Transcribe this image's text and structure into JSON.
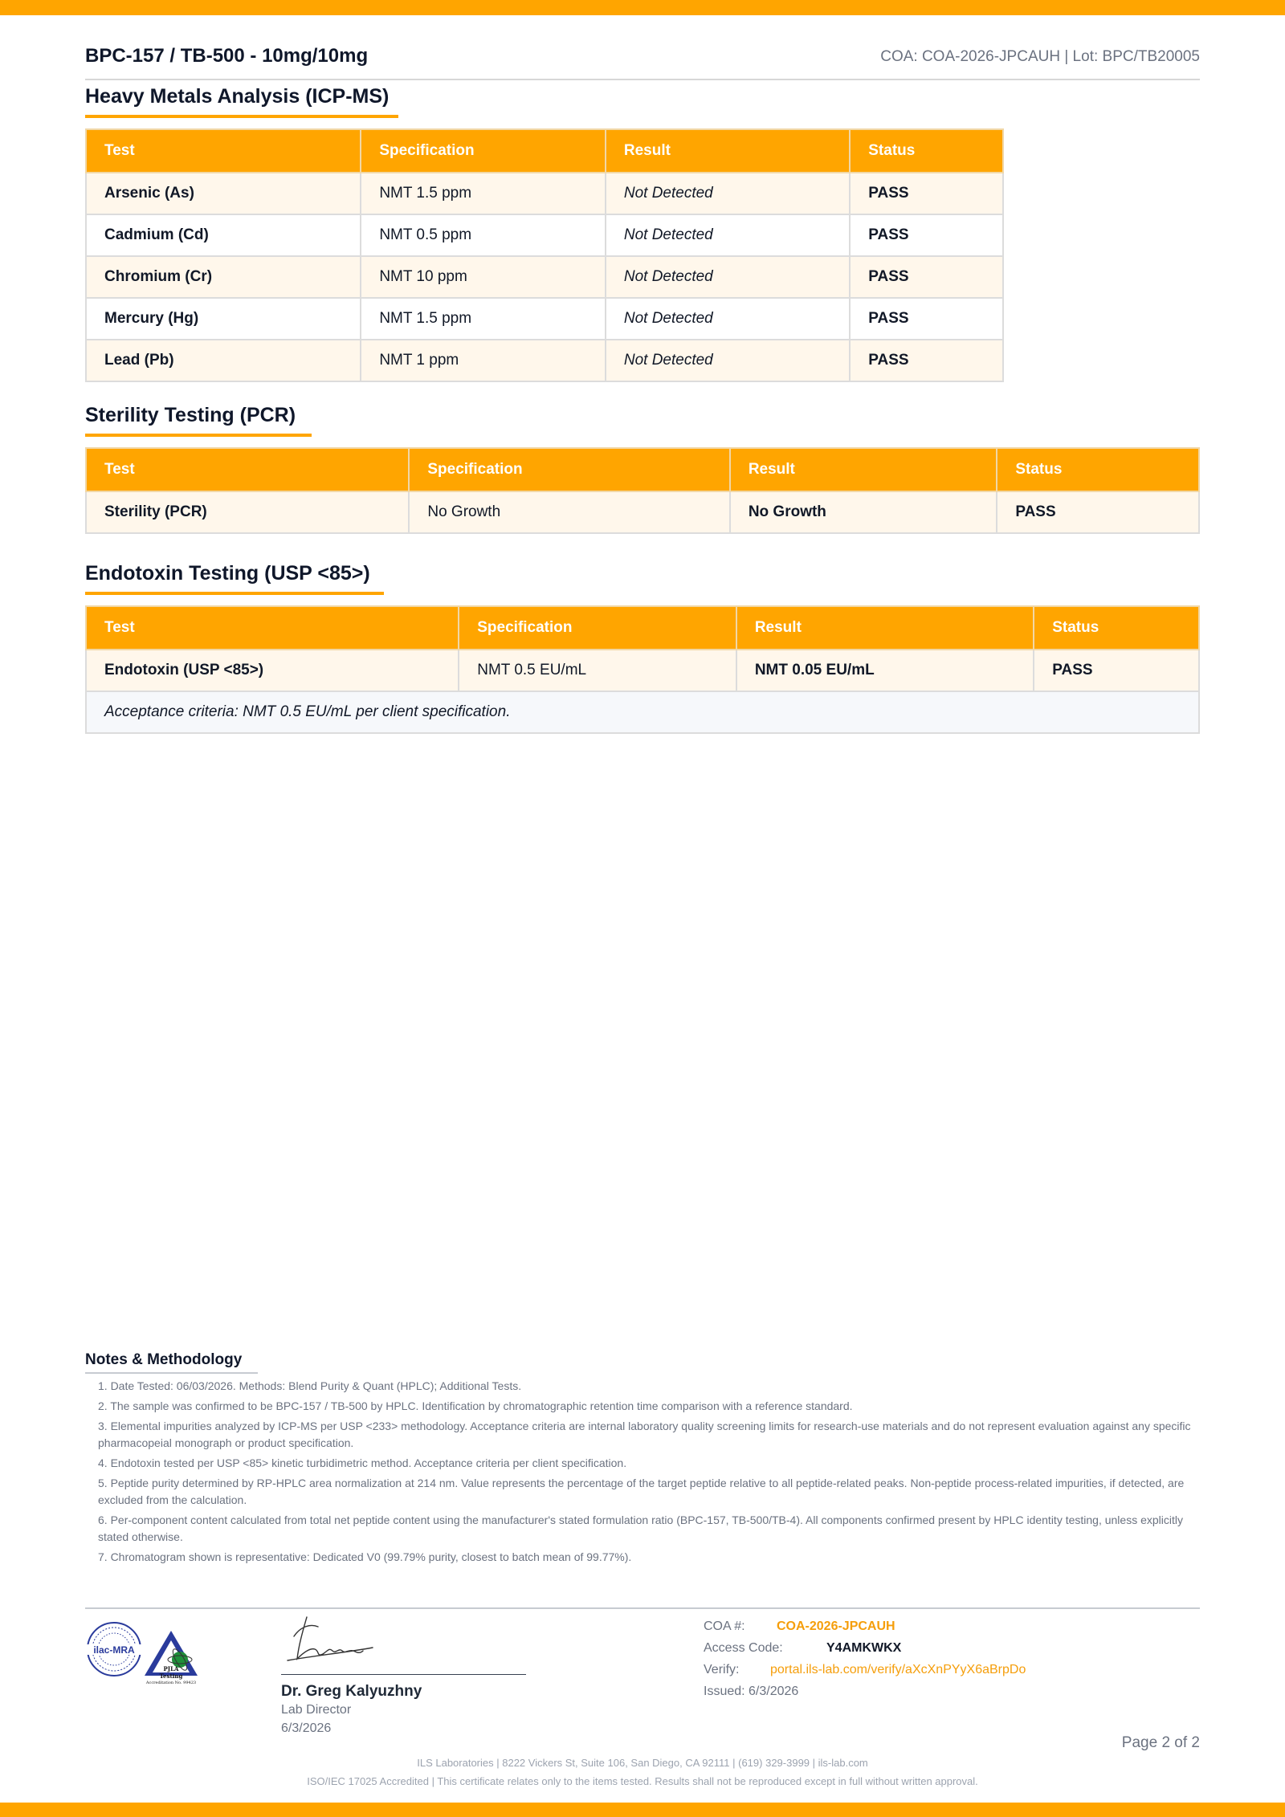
{
  "header": {
    "product": "BPC-157 / TB-500 - 10mg/10mg",
    "coa_lot": "COA: COA-2026-JPCAUH  |  Lot: BPC/TB20005"
  },
  "heavy_metals": {
    "title": "Heavy Metals Analysis (ICP-MS)",
    "columns": [
      "Test",
      "Specification",
      "Result",
      "Status"
    ],
    "rows": [
      {
        "test": "Arsenic (As)",
        "spec": "NMT 1.5 ppm",
        "result": "Not Detected",
        "status": "PASS"
      },
      {
        "test": "Cadmium (Cd)",
        "spec": "NMT 0.5 ppm",
        "result": "Not Detected",
        "status": "PASS"
      },
      {
        "test": "Chromium (Cr)",
        "spec": "NMT 10 ppm",
        "result": "Not Detected",
        "status": "PASS"
      },
      {
        "test": "Mercury (Hg)",
        "spec": "NMT 1.5 ppm",
        "result": "Not Detected",
        "status": "PASS"
      },
      {
        "test": "Lead (Pb)",
        "spec": "NMT 1 ppm",
        "result": "Not Detected",
        "status": "PASS"
      }
    ]
  },
  "sterility": {
    "title": "Sterility Testing (PCR)",
    "columns": [
      "Test",
      "Specification",
      "Result",
      "Status"
    ],
    "rows": [
      {
        "test": "Sterility (PCR)",
        "spec": "No Growth",
        "result": "No Growth",
        "status": "PASS"
      }
    ]
  },
  "endotoxin": {
    "title": "Endotoxin Testing (USP <85>)",
    "columns": [
      "Test",
      "Specification",
      "Result",
      "Status"
    ],
    "rows": [
      {
        "test": "Endotoxin (USP <85>)",
        "spec": "NMT 0.5 EU/mL",
        "result": "NMT 0.05 EU/mL",
        "status": "PASS"
      }
    ],
    "note": "Acceptance criteria: NMT 0.5 EU/mL per client specification."
  },
  "notes": {
    "title": "Notes & Methodology",
    "items": [
      "1. Date Tested: 06/03/2026. Methods: Blend Purity & Quant (HPLC); Additional Tests.",
      "2. The sample was confirmed to be BPC-157 / TB-500 by HPLC. Identification by chromatographic retention time comparison with a reference standard.",
      "3. Elemental impurities analyzed by ICP-MS per USP <233> methodology. Acceptance criteria are internal laboratory quality screening limits for research-use materials and do not represent evaluation against any specific pharmacopeial monograph or product specification.",
      "4. Endotoxin tested per USP <85> kinetic turbidimetric method. Acceptance criteria per client specification.",
      "5. Peptide purity determined by RP-HPLC area normalization at 214 nm. Value represents the percentage of the target peptide relative to all peptide-related peaks. Non-peptide process-related impurities, if detected, are excluded from the calculation.",
      "6. Per-component content calculated from total net peptide content using the manufacturer's stated formulation ratio (BPC-157, TB-500/TB-4). All components confirmed present by HPLC identity testing, unless explicitly stated otherwise.",
      "7. Chromatogram shown is representative: Dedicated V0 (99.79% purity, closest to batch mean of 99.77%)."
    ]
  },
  "logos": {
    "ilac": "ilac-MRA",
    "pjla": "PJLA",
    "pjla_sub": "Testing",
    "pjla_accr": "Accreditation No. 99423"
  },
  "signature": {
    "name": "Dr. Greg Kalyuzhny",
    "role": "Lab Director",
    "date": "6/3/2026"
  },
  "certificate": {
    "coa_label": "COA #:",
    "coa_value": "COA-2026-JPCAUH",
    "access_label": "Access Code:",
    "access_value": "Y4AMKWKX",
    "verify_label": "Verify:",
    "verify_value": "portal.ils-lab.com/verify/aXcXnPYyX6aBrpDo",
    "issued": "Issued: 6/3/2026"
  },
  "page": "Page 2 of 2",
  "footer": {
    "line1": "ILS Laboratories  |  8222 Vickers St, Suite 106, San Diego, CA 92111  |  (619) 329-3999  |  ils-lab.com",
    "line2": "ISO/IEC 17025 Accredited  |  This certificate relates only to the items tested. Results shall not be reproduced except in full without written approval."
  },
  "colors": {
    "accent": "#ffa500",
    "pass": "#16a34a",
    "heading": "#0f172a"
  }
}
